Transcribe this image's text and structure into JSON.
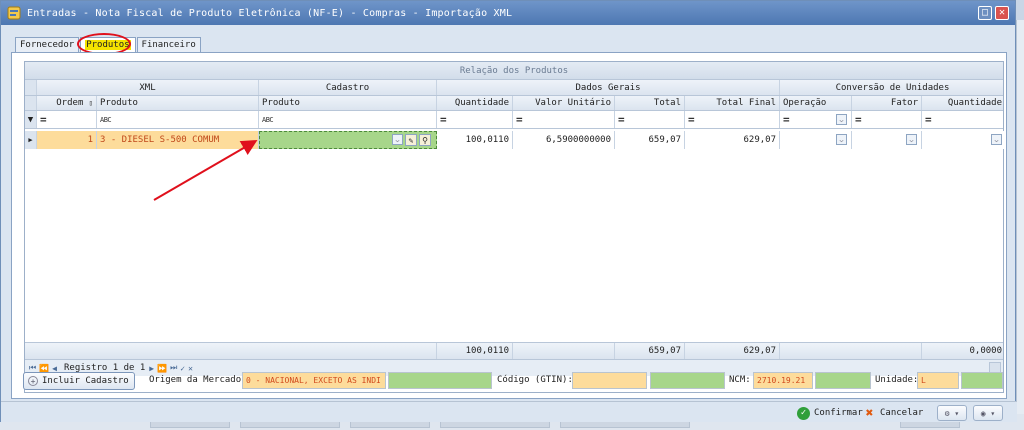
{
  "window": {
    "title": "Entradas - Nota Fiscal de Produto Eletrônica (NF-E) - Compras - Importação XML",
    "max_glyph": "□",
    "close_glyph": "✕"
  },
  "tabs": [
    {
      "label": "Fornecedor"
    },
    {
      "label": "Produtos"
    },
    {
      "label": "Financeiro"
    }
  ],
  "grid": {
    "caption": "Relação dos Produtos",
    "bands": [
      "XML",
      "Cadastro",
      "Dados Gerais",
      "Conversão de Unidades"
    ],
    "columns": [
      "Ordem",
      "Produto",
      "Produto",
      "Quantidade",
      "Valor Unitário",
      "Total",
      "Total Final",
      "Operação",
      "Fator",
      "Quantidade"
    ],
    "filter": {
      "eq": "=",
      "abc": "ABC"
    },
    "row": {
      "ordem": "1",
      "xml_produto": "3 - DIESEL S-500 COMUM",
      "cadastro_produto": "",
      "quantidade": "100,0110",
      "valor_unitario": "6,5900000000",
      "total": "659,07",
      "total_final": "629,07"
    },
    "footer": {
      "quantidade": "100,0110",
      "total": "659,07",
      "total_final": "629,07",
      "conv_quantidade": "0,0000"
    },
    "navigator": {
      "text": "Registro 1 de 1"
    }
  },
  "bottom": {
    "incluir_label": "Incluir Cadastro",
    "origem_label": "Origem da Mercadoria:",
    "origem_value": "0 - NACIONAL, EXCETO AS INDI",
    "gtin_label": "Código (GTIN):",
    "gtin_value": "",
    "ncm_label": "NCM:",
    "ncm_value": "2710.19.21",
    "unidade_label": "Unidade:",
    "unidade_value": "L"
  },
  "actions": {
    "confirmar": "Confirmar",
    "cancelar": "Cancelar"
  },
  "colors": {
    "orange_cell": "#fddc9b",
    "green_cell": "#a7d68a",
    "title_bar": "#4d77b2",
    "annotation": "#e0101c"
  }
}
